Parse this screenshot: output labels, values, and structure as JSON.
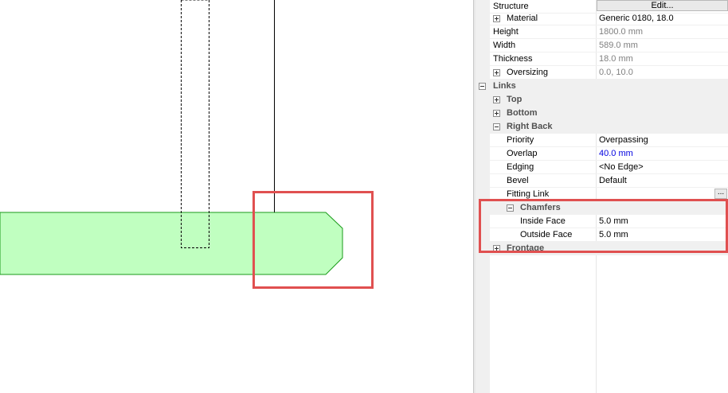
{
  "properties": {
    "structure": {
      "label": "Structure",
      "edit_label": "Edit..."
    },
    "material": {
      "label": "Material",
      "value": "Generic 0180, 18.0"
    },
    "height": {
      "label": "Height",
      "value": "1800.0 mm"
    },
    "width": {
      "label": "Width",
      "value": "589.0 mm"
    },
    "thickness": {
      "label": "Thickness",
      "value": "18.0 mm"
    },
    "oversizing": {
      "label": "Oversizing",
      "value": "0.0, 10.0"
    },
    "links": {
      "label": "Links",
      "top": {
        "label": "Top"
      },
      "bottom": {
        "label": "Bottom"
      },
      "right_back": {
        "label": "Right Back",
        "priority": {
          "label": "Priority",
          "value": "Overpassing"
        },
        "overlap": {
          "label": "Overlap",
          "value": "40.0 mm"
        },
        "edging": {
          "label": "Edging",
          "value": "<No Edge>"
        },
        "bevel": {
          "label": "Bevel",
          "value": "Default"
        },
        "fitting_link": {
          "label": "Fitting Link",
          "button_label": "..."
        },
        "chamfers": {
          "label": "Chamfers",
          "inside_face": {
            "label": "Inside Face",
            "value": "5.0 mm"
          },
          "outside_face": {
            "label": "Outside Face",
            "value": "5.0 mm"
          }
        }
      },
      "frontage": {
        "label": "Frontage"
      }
    }
  },
  "colors": {
    "panel_fill": "#c0ffc0",
    "panel_stroke": "#1a9a1a",
    "highlight": "#e05050",
    "emphasized_value": "#0000e0"
  }
}
